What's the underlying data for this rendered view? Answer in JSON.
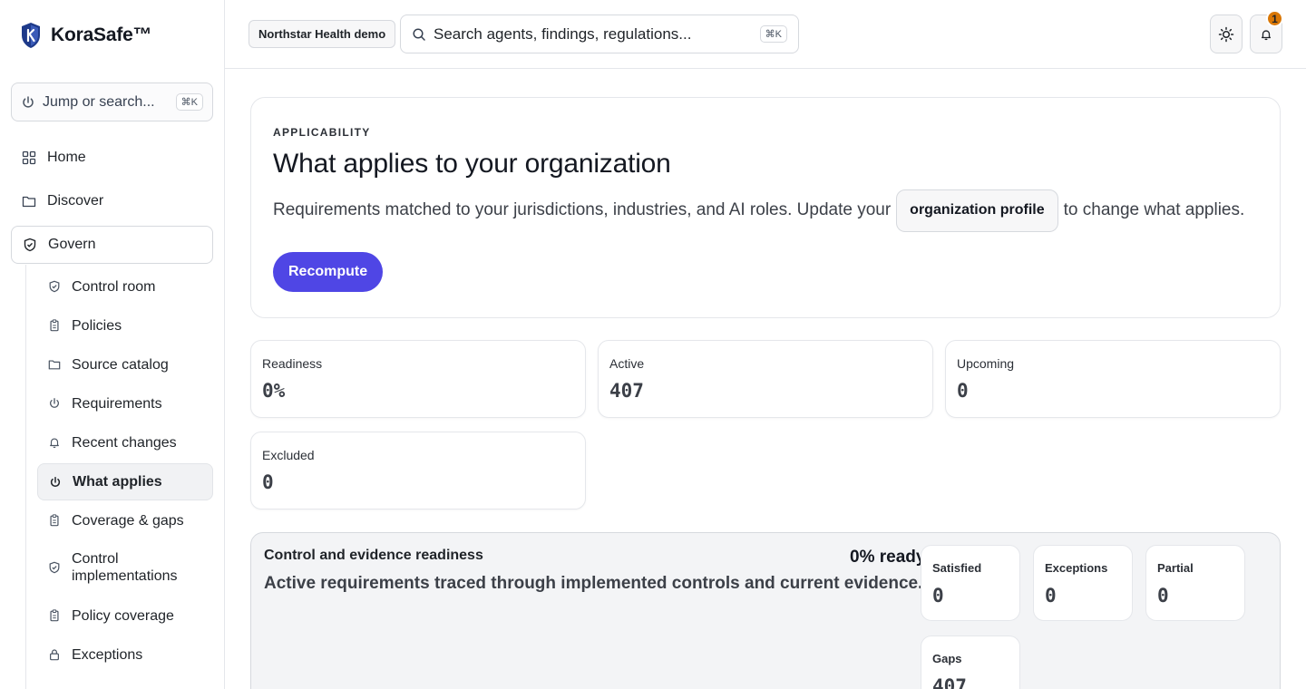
{
  "brand": {
    "name": "KoraSafe™",
    "logo_icon": "shield-k-logo"
  },
  "sidebar": {
    "jump": {
      "placeholder": "Jump or search...",
      "shortcut": "⌘K"
    },
    "top_items": [
      {
        "label": "Home",
        "icon": "grid-icon"
      },
      {
        "label": "Discover",
        "icon": "folder-icon"
      },
      {
        "label": "Govern",
        "icon": "shield-icon",
        "active": true
      }
    ],
    "sub_items": [
      {
        "label": "Control room",
        "icon": "shield-icon"
      },
      {
        "label": "Policies",
        "icon": "clipboard-icon"
      },
      {
        "label": "Source catalog",
        "icon": "folder-icon"
      },
      {
        "label": "Requirements",
        "icon": "power-icon"
      },
      {
        "label": "Recent changes",
        "icon": "bell-icon"
      },
      {
        "label": "What applies",
        "icon": "power-icon",
        "active": true
      },
      {
        "label": "Coverage & gaps",
        "icon": "clipboard-icon"
      },
      {
        "label": "Control implementations",
        "icon": "shield-icon"
      },
      {
        "label": "Policy coverage",
        "icon": "clipboard-icon"
      },
      {
        "label": "Exceptions",
        "icon": "lock-icon"
      }
    ]
  },
  "topbar": {
    "org": "Northstar Health demo",
    "search": {
      "placeholder": "Search agents, findings, regulations...",
      "shortcut": "⌘K"
    },
    "notifications_count": "1"
  },
  "main": {
    "eyebrow": "APPLICABILITY",
    "title": "What applies to your organization",
    "desc_before": "Requirements matched to your jurisdictions, industries, and AI roles. Update your",
    "profile_link": "organization profile",
    "desc_after": "to change what applies.",
    "recompute": "Recompute",
    "stats": [
      {
        "label": "Readiness",
        "value": "0%"
      },
      {
        "label": "Active",
        "value": "407"
      },
      {
        "label": "Upcoming",
        "value": "0"
      },
      {
        "label": "Excluded",
        "value": "0"
      }
    ],
    "readiness": {
      "title": "Control and evidence readiness",
      "subtitle": "Active requirements traced through implemented controls and current evidence.",
      "percent": "0% ready",
      "metrics": [
        {
          "label": "Satisfied",
          "value": "0"
        },
        {
          "label": "Exceptions",
          "value": "0"
        },
        {
          "label": "Partial",
          "value": "0"
        },
        {
          "label": "Gaps",
          "value": "407"
        }
      ]
    }
  },
  "colors": {
    "primary": "#4f46e5",
    "badge": "#d97706",
    "logo": "#1e3a8a"
  }
}
